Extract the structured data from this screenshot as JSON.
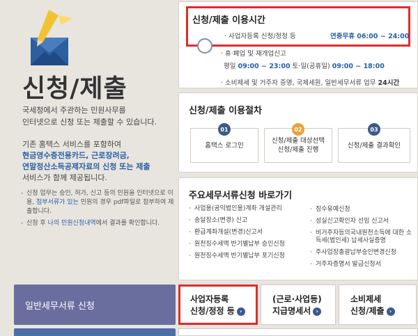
{
  "page": {
    "title": "신청/제출"
  },
  "intro": {
    "line1": "국세청에서 주관하는 민원사무를",
    "line2": "인터넷으로 신청 또는 제출할 수 있습니다.",
    "p2_line1": "기존 홈택스 서비스를 포함하여",
    "p2_link1": "현금영수증전용카드, 근로장려금,",
    "p2_link2": "연말정산소득공제자료의 신청 또는 제출",
    "p2_line4": "서비스가 함께 제공됩니다."
  },
  "notes": [
    {
      "text_a": "신청 업무는 승인, 허가, 신고 등의 민원을 인터넷으로 이용, ",
      "hl": "첨부서류가 있는",
      "text_b": " 민원의 경우 pdf파일로 첨부하여 제출합니다."
    },
    {
      "text_a": "신청 후 ",
      "hl": "나의 민원신청내역",
      "text_b": "에서 결과를 확인합니다."
    }
  ],
  "hours": {
    "title": "신청/제출 이용시간",
    "row1_label": "사업자등록 신청/정정 등",
    "row1_time": "연중무휴 06:00 ~ 24:00",
    "row2_label": "휴·폐업 및 재개업신고",
    "row3_a": "평일 ",
    "row3_b": "09:00 ~ 23:00",
    "row3_c": " 토·일(공휴일) ",
    "row3_d": "09:00 ~ 18:00",
    "row4_label": "소비제세 및 거주자 증명, 국제세원, 일반세무서류 업무",
    "row4_time": "24시간"
  },
  "procedure": {
    "title": "신청/제출 이용절차",
    "steps": [
      {
        "num": "01",
        "line1": "홈택스 로그인",
        "line2": "",
        "color": "#3b5a8c"
      },
      {
        "num": "02",
        "line1": "신청/제출 대상선택",
        "line2": "신청/제출 진행",
        "color": "#e8a33c"
      },
      {
        "num": "03",
        "line1": "신청/제출 결과확인",
        "line2": "",
        "color": "#3b5a8c"
      }
    ]
  },
  "docs": {
    "title": "주요세무서류신청 바로가기",
    "left": [
      "사업용(공익법인용)계좌 개설관리",
      "송달장소(변경) 신고",
      "환급계좌개설(변경)신고서",
      "원천징수세액 반기별납부 승인신청",
      "원천징수세액 반기별납부 포기신청"
    ],
    "right": [
      "징수유예신청",
      "성실신고확인자 선임 신고서",
      "비거주자등의국내원천소득에 대한 소득세(법인세) 납세사실증명",
      "주사업장총괄납부승인변경신청",
      "거주자증명서 발급신청서"
    ]
  },
  "quick": {
    "general": "일반세무서류 신청",
    "biz_line1": "사업자등록",
    "biz_line2": "신청/정정 등",
    "work_line1": "(근로·사업등)",
    "work_line2": "지급명세서",
    "cons_line1": "소비제세",
    "cons_line2": "신청/제출",
    "go_icon": "›"
  }
}
